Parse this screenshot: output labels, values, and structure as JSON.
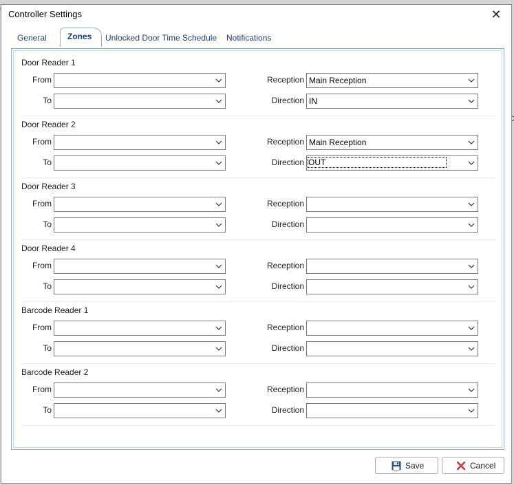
{
  "window": {
    "title": "Controller Settings"
  },
  "tabs": [
    {
      "label": "General",
      "active": false
    },
    {
      "label": "Zones",
      "active": true
    },
    {
      "label": "Unlocked Door Time Schedule",
      "active": false
    },
    {
      "label": "Notifications",
      "active": false
    }
  ],
  "field_labels": {
    "from": "From",
    "to": "To",
    "reception": "Reception",
    "direction": "Direction"
  },
  "readers": [
    {
      "name": "Door Reader 1",
      "from": "",
      "to": "",
      "reception": "Main Reception",
      "direction": "IN"
    },
    {
      "name": "Door Reader 2",
      "from": "",
      "to": "",
      "reception": "Main Reception",
      "direction": "OUT"
    },
    {
      "name": "Door Reader 3",
      "from": "",
      "to": "",
      "reception": "",
      "direction": ""
    },
    {
      "name": "Door Reader 4",
      "from": "",
      "to": "",
      "reception": "",
      "direction": ""
    },
    {
      "name": "Barcode Reader 1",
      "from": "",
      "to": "",
      "reception": "",
      "direction": ""
    },
    {
      "name": "Barcode Reader 2",
      "from": "",
      "to": "",
      "reception": "",
      "direction": ""
    }
  ],
  "buttons": {
    "save": "Save",
    "cancel": "Cancel"
  },
  "background_fragments": {
    "left_top": "t",
    "right_mid": "C"
  },
  "colors": {
    "tab_text": "#1f3f7a",
    "panel_border": "#8fb0d8",
    "cancel_icon": "#d32f2f",
    "save_icon": "#2b4f85"
  },
  "icons": {
    "close": "close-icon",
    "save": "floppy-disk-icon",
    "cancel": "red-x-icon",
    "dropdown": "chevron-down-icon"
  }
}
